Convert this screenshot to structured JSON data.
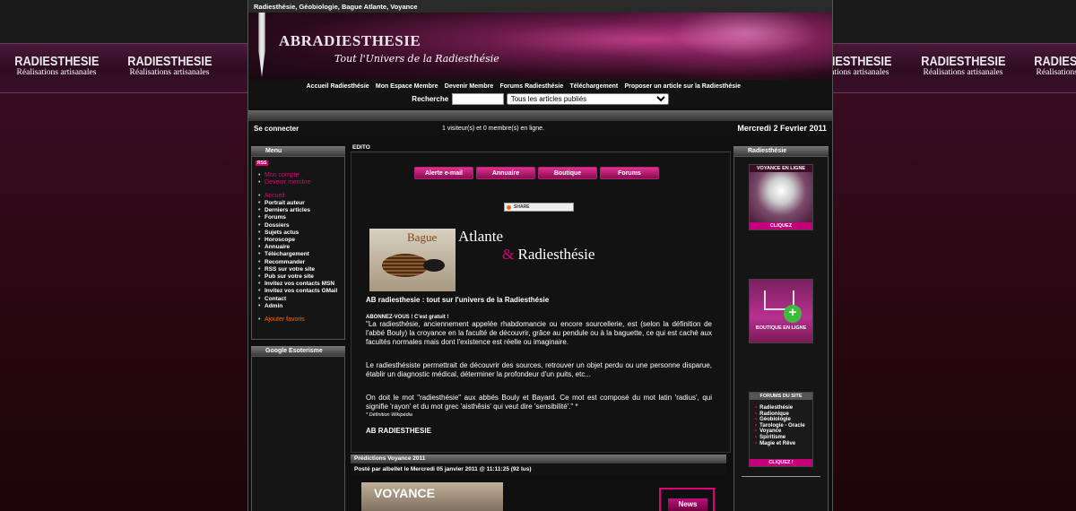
{
  "browser_title": "Radiesthésie, Géobiologie, Bague Atlante, Voyance",
  "band_logos": [
    {
      "big": "RADIESTHESIE",
      "small": "Réalisations artisanales"
    },
    {
      "big": "RADIESTHESIE",
      "small": "Réalisations artisanales"
    },
    {
      "big": "RADIESTHESIE",
      "small": "Réalisations artisanales"
    },
    {
      "big": "RADIESTHESIE",
      "small": "Réalisations artisanales"
    },
    {
      "big": "RADIESTHESIE",
      "small": "Réalisations artisanales"
    }
  ],
  "header": {
    "title": "ABRADIESTHESIE",
    "slogan": "Tout l'Univers de la Radiesthésie"
  },
  "nav": {
    "items": [
      "Accueil Radiesthésie",
      "Mon Espace Membre",
      "Devenir Membre",
      "Forums Radiesthésie",
      "Téléchargement",
      "Proposer un article sur la Radiesthésie"
    ]
  },
  "search": {
    "label": "Recherche",
    "input_value": "",
    "select_value": "Tous les articles publiés"
  },
  "status": {
    "login": "Se connecter",
    "visitors": "1 visiteur(s) et 0 membre(s) en ligne.",
    "date": "Mercredi 2 Fevrier 2011"
  },
  "left": {
    "menu_title": "Menu",
    "rss": "RSS",
    "account_items": [
      "Mon compte",
      "Devenir membre"
    ],
    "accueil": "Accueil",
    "menu_items": [
      "Portrait auteur",
      "Derniers articles",
      "Forums",
      "Dossiers",
      "Sujets actus",
      "Horoscope",
      "Annuaire",
      "Téléchargement",
      "Recommander",
      "RSS sur votre site",
      "Pub sur votre site",
      "Invitez vos contacts MSN",
      "Invitez vos contacts GMail",
      "Contact",
      "Admin"
    ],
    "favoris": "Ajouter favoris",
    "google_title": "Google Esoterisme"
  },
  "right": {
    "title": "Radiesthésie",
    "ad1_top": "VOYANCE EN LIGNE",
    "ad1_bot": "CLIQUEZ",
    "ad2_text": "BOUTIQUE EN LIGNE",
    "ad3_top": "FORUMS DU SITE",
    "ad3_items": [
      "Radiesthésie",
      "Radionique",
      "Géobiologie",
      "Tarologie - Oracle",
      "Voyance",
      "Spiritisme",
      "Magie et Rêve"
    ],
    "ad3_bot": "CLIQUEZ !"
  },
  "center": {
    "edito_title": "EDITO",
    "buttons": [
      "Alerte e-mail",
      "Annuaire",
      "Boutique",
      "Forums"
    ],
    "share_label": "SHARE",
    "bague_text": "Bague",
    "title_atlante": "Atlante",
    "title_amp": "&",
    "title_radiesthesie": "Radiesthésie",
    "article_heading": "AB radiesthesie : tout sur l'univers de la Radiesthésie",
    "abonnez": "ABONNEZ-VOUS !   C'est gratuit !",
    "p1": "\"La radiesthésie, anciennement appelée rhabdomancie ou encore sourcellerie, est (selon la définition de l'abbé Bouly) la croyance en la faculté de découvrir, grâce au pendule ou à la baguette, ce qui est caché aux facultés normales mais dont l'existence est réelle ou imaginaire.",
    "p2": "Le radiesthésiste permettrait de découvrir des sources, retrouver un objet perdu ou une personne disparue, établir un diagnostic médical, déterminer la profondeur d'un puits, etc...",
    "p3": "On doit le mot \"radiesthésie\" aux abbés Bouly et Bayard. Ce mot est composé du mot latin 'radius', qui signifie 'rayon' et du mot grec 'aisthêsis' qui veut dire 'sensibilité'.\" *",
    "footnote": "* Définition Wikipédia",
    "signature": "AB RADIESTHESIE"
  },
  "prediction": {
    "title": "Prédictions Voyance 2011",
    "meta_prefix": "Posté par",
    "meta_author": "albellet",
    "meta_suffix": "le Mercredi 05 janvier 2011 @ 11:11:25 (92 lus)",
    "image_text": "VOYANCE",
    "news_label": "News"
  }
}
